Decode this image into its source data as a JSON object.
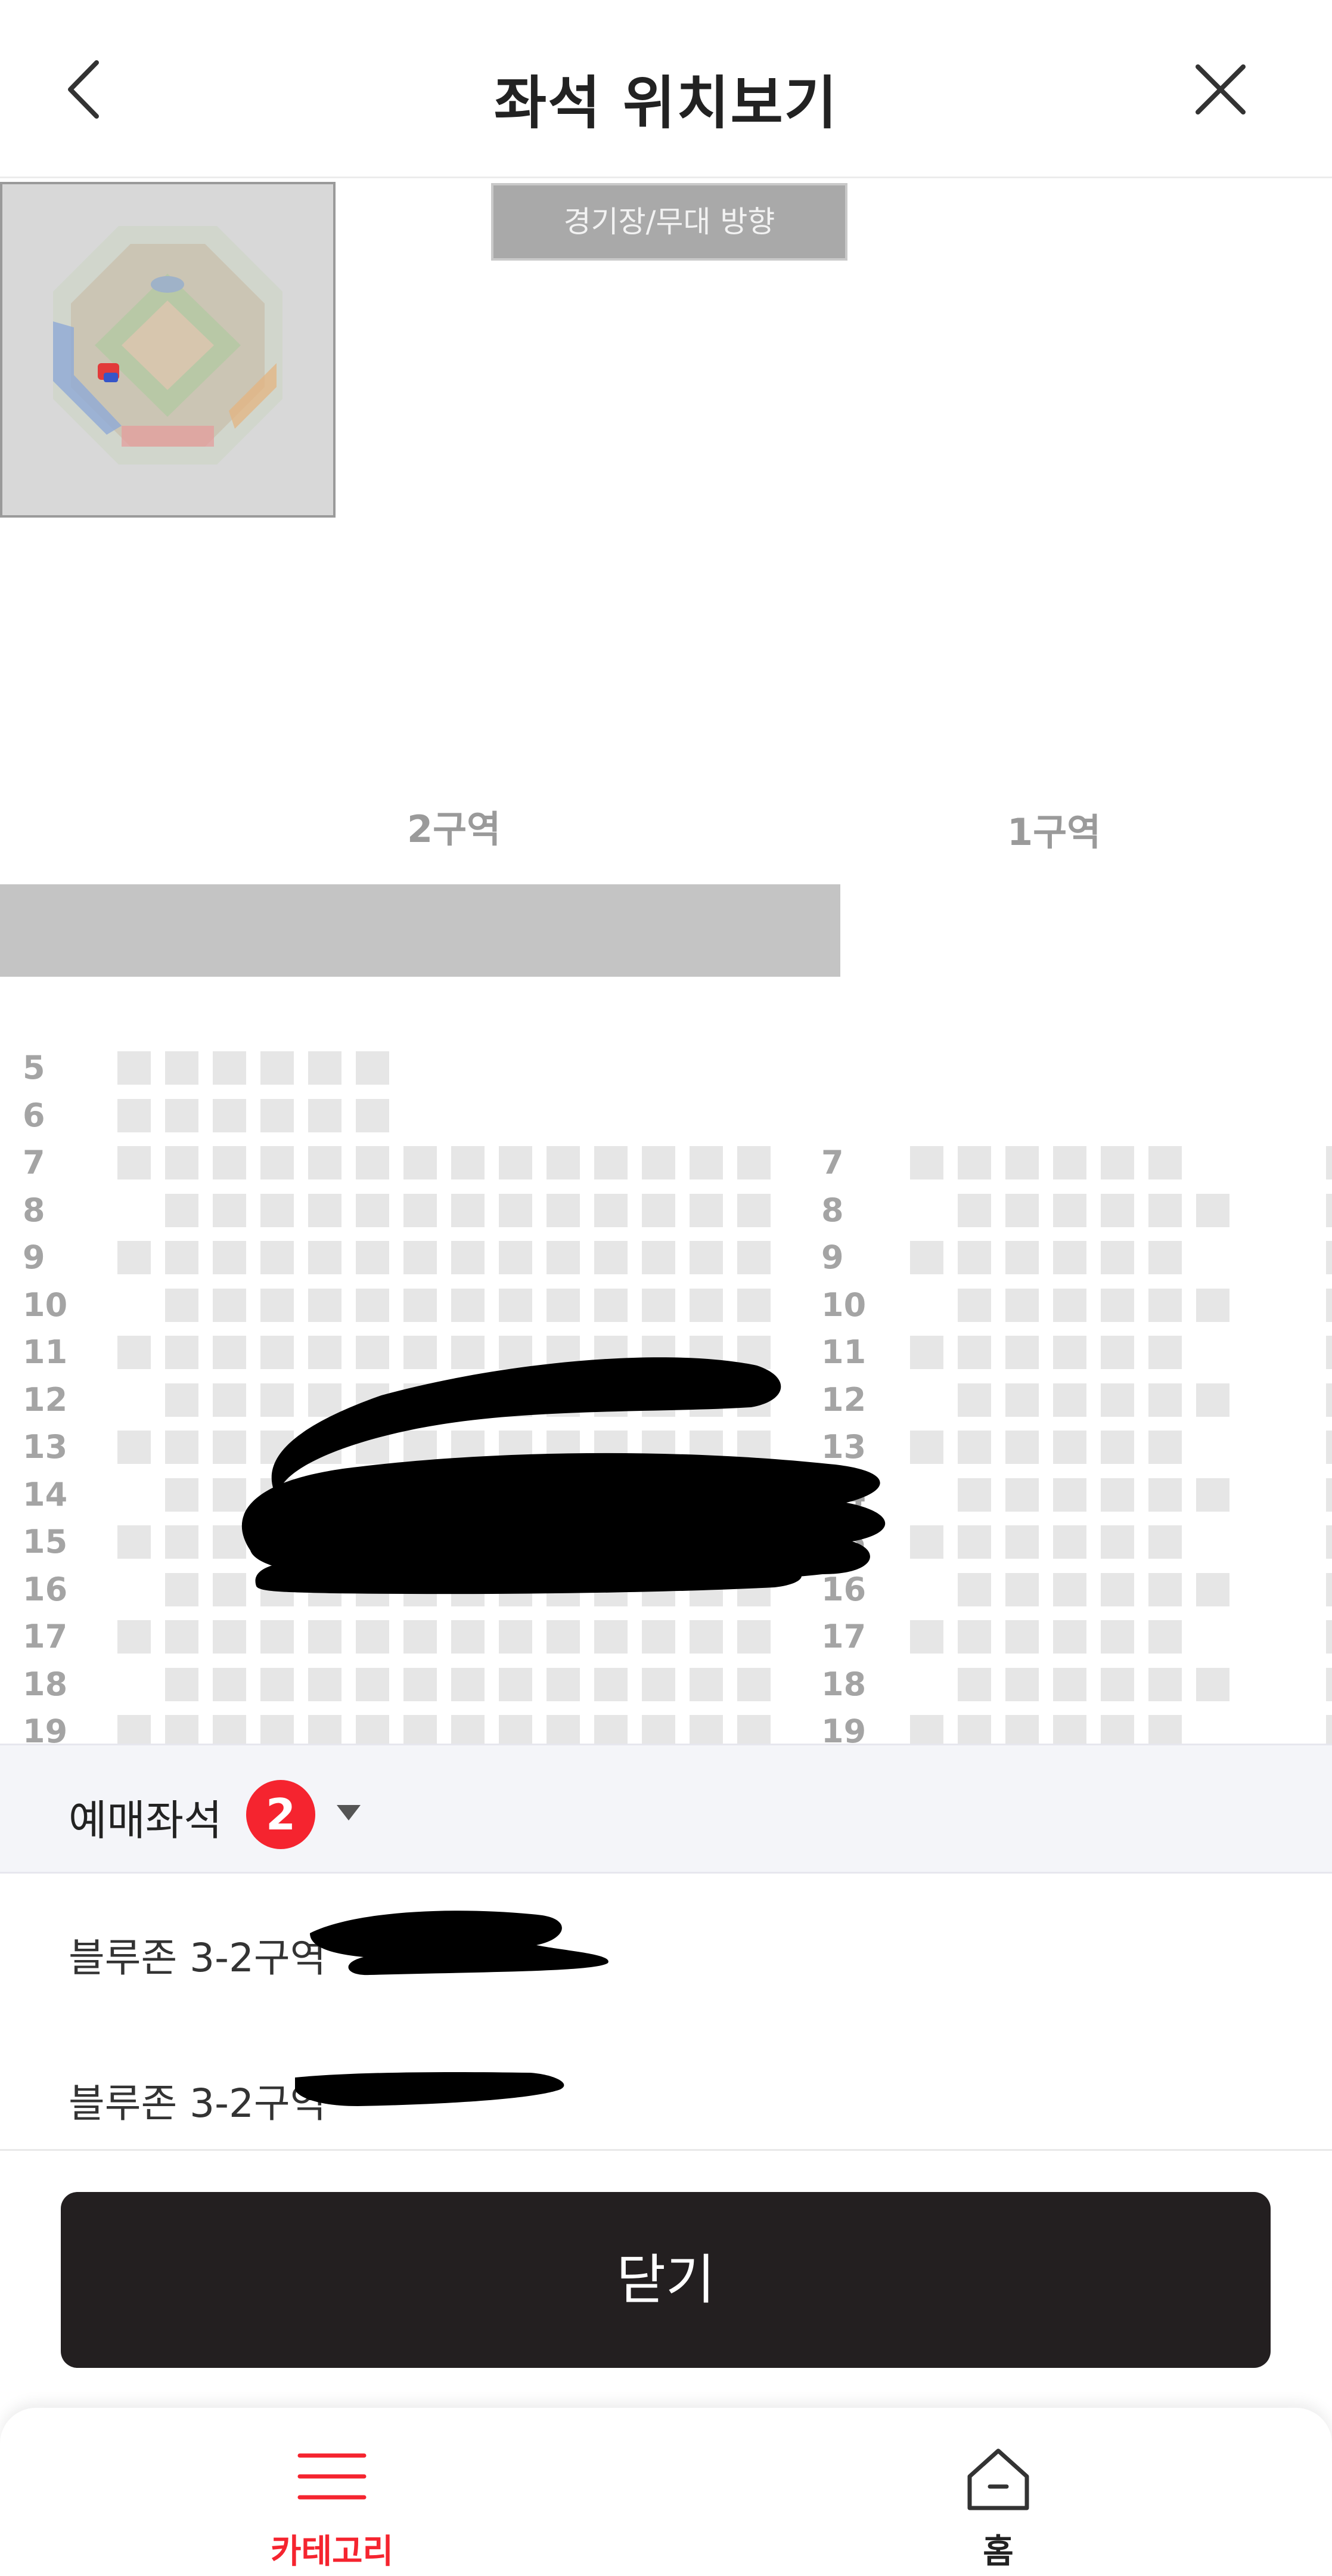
{
  "header": {
    "title": "좌석 위치보기",
    "back_icon": "chevron-left-icon",
    "close_icon": "close-icon"
  },
  "stage_direction": "경기장/무대 방향",
  "zones": [
    "2구역",
    "1구역"
  ],
  "seat_map": {
    "left_rows": [
      "5",
      "6",
      "7",
      "8",
      "9",
      "10",
      "11",
      "12",
      "13",
      "14",
      "15",
      "16",
      "17",
      "18",
      "19"
    ],
    "right_rows": [
      "7",
      "8",
      "9",
      "10",
      "11",
      "12",
      "13",
      "14",
      "15",
      "16",
      "17",
      "18",
      "19"
    ]
  },
  "booked": {
    "label": "예매좌석",
    "count": "2",
    "items": [
      {
        "label": "블루존 3-2구역"
      },
      {
        "label": "블루존 3-2구역"
      }
    ]
  },
  "close_button": "닫기",
  "bottom_nav": {
    "items": [
      {
        "label": "카테고리",
        "icon": "menu-icon",
        "active": true
      },
      {
        "label": "홈",
        "icon": "home-icon",
        "active": false
      }
    ]
  },
  "colors": {
    "accent": "#f5242f",
    "button": "#231f20",
    "seat": "#e6e6e6"
  }
}
